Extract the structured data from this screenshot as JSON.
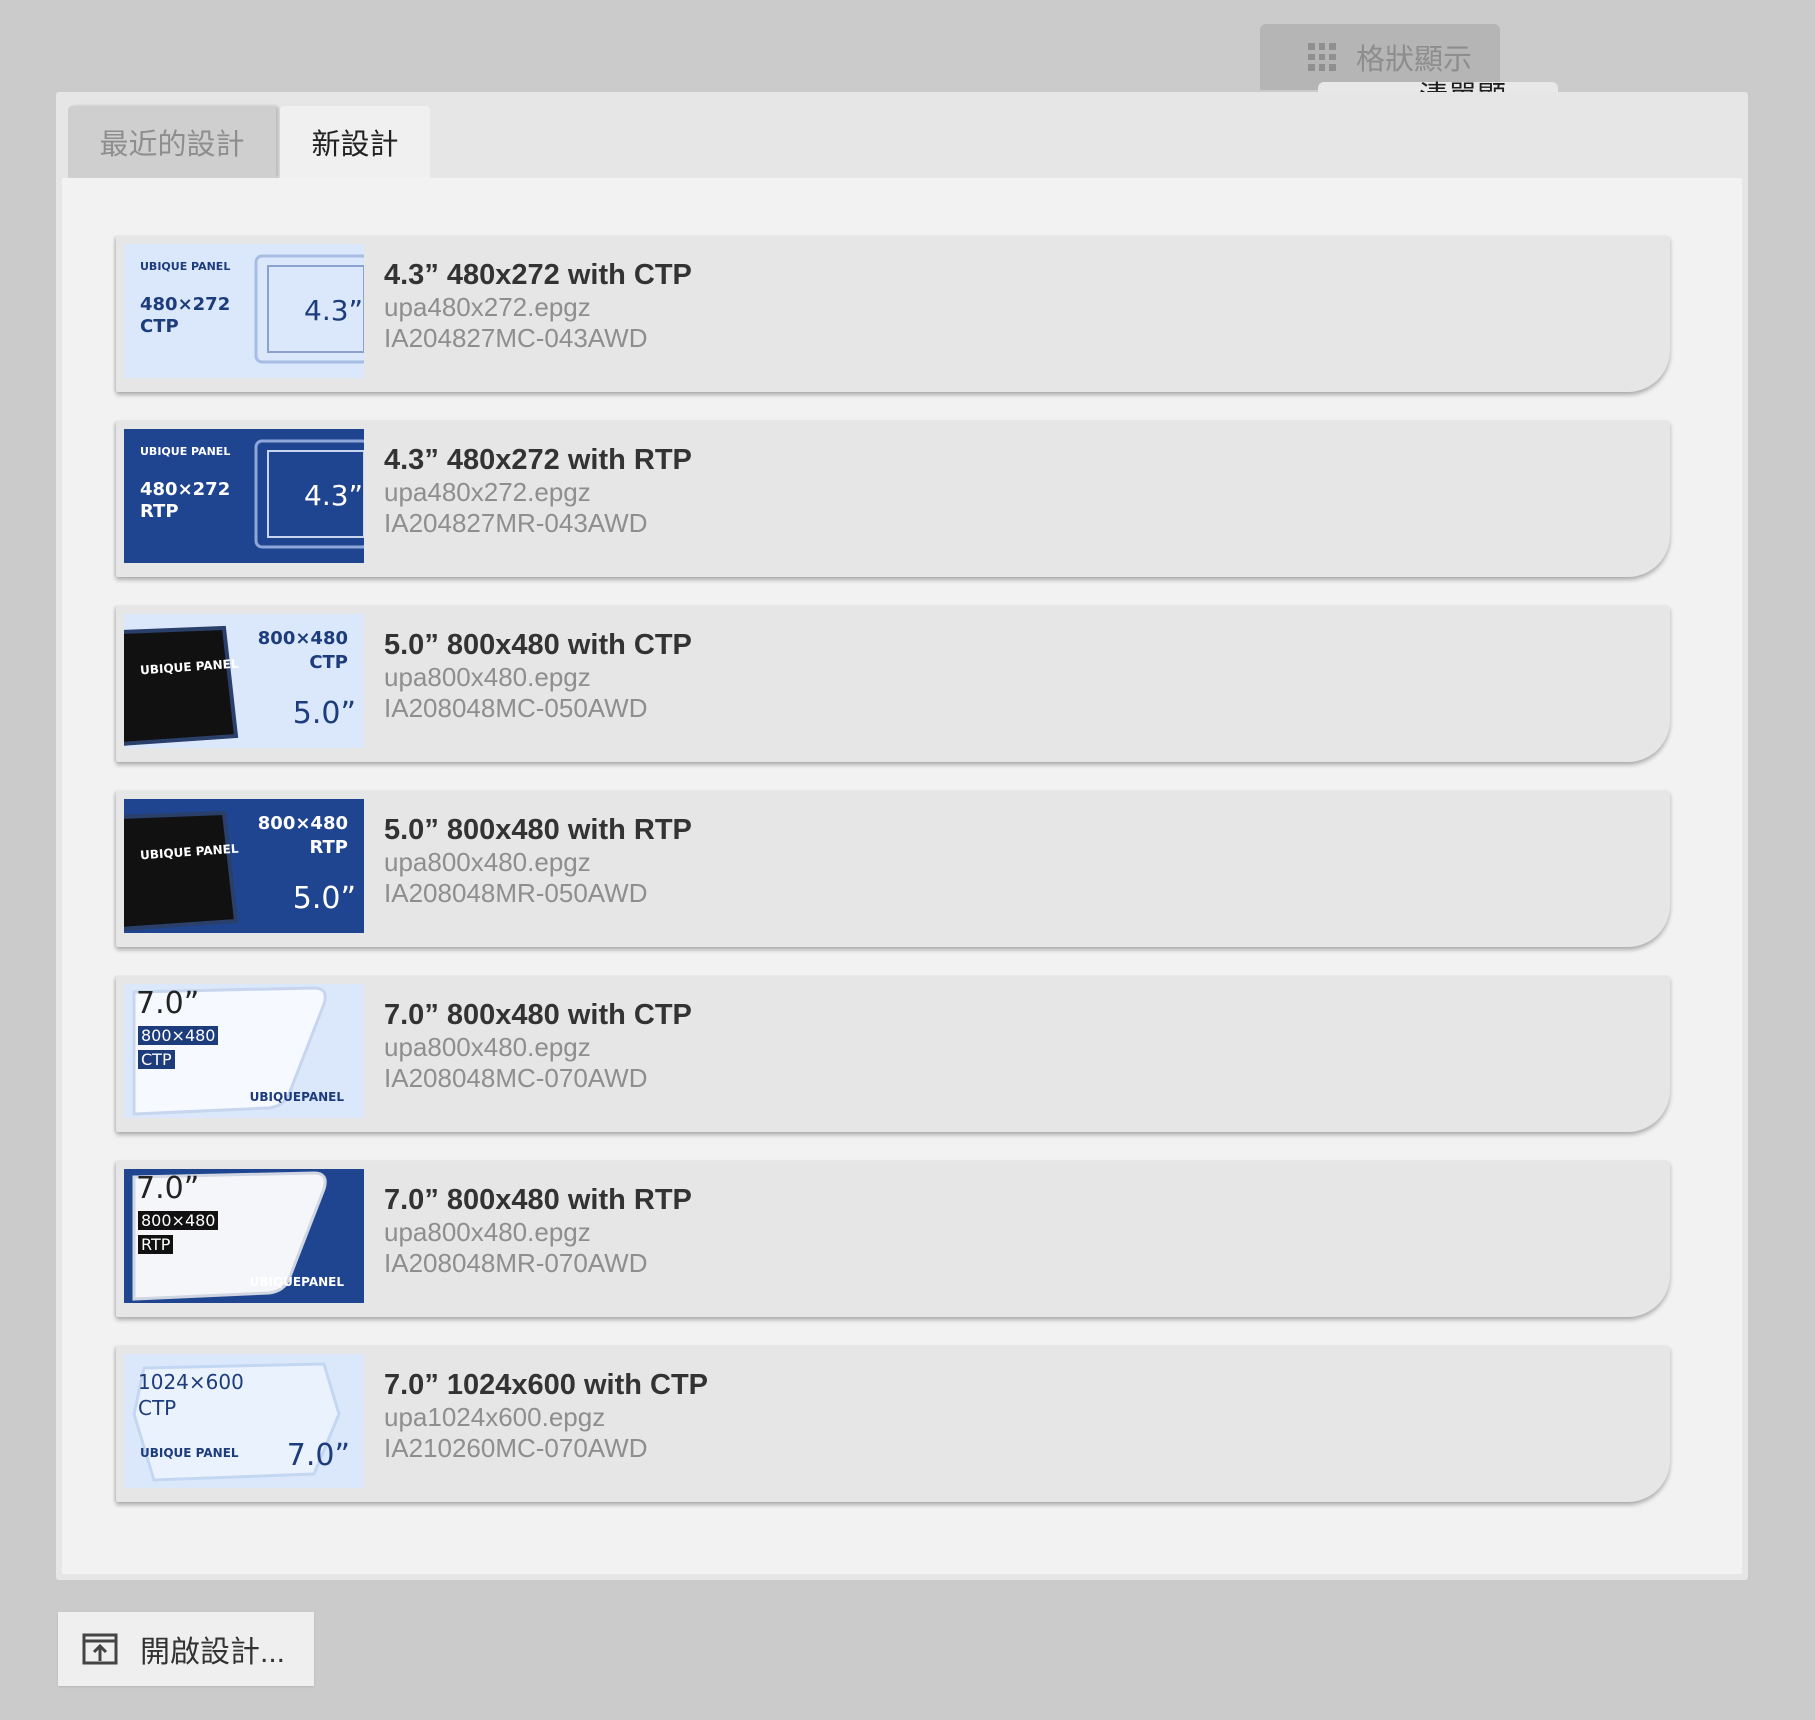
{
  "view_toggle": {
    "grid_label": "格狀顯示",
    "list_label": "清單顯示",
    "active": "list"
  },
  "tabs": [
    {
      "label": "最近的設計",
      "active": false
    },
    {
      "label": "新設計",
      "active": true
    }
  ],
  "designs": [
    {
      "title": "4.3” 480x272 with CTP",
      "file": "upa480x272.epgz",
      "part": "IA204827MC-043AWD",
      "thumb": {
        "style": "light",
        "brand": "UBIQUE PANEL",
        "line1": "480×272",
        "line2": "CTP",
        "size": "4.3”"
      }
    },
    {
      "title": "4.3” 480x272 with RTP",
      "file": "upa480x272.epgz",
      "part": "IA204827MR-043AWD",
      "thumb": {
        "style": "dark",
        "brand": "UBIQUE PANEL",
        "line1": "480×272",
        "line2": "RTP",
        "size": "4.3”"
      }
    },
    {
      "title": "5.0” 800x480 with CTP",
      "file": "upa800x480.epgz",
      "part": "IA208048MC-050AWD",
      "thumb": {
        "style": "light",
        "brand": "UBIQUE PANEL",
        "line1": "800×480",
        "line2": "CTP",
        "size": "5.0”"
      }
    },
    {
      "title": "5.0” 800x480 with RTP",
      "file": "upa800x480.epgz",
      "part": "IA208048MR-050AWD",
      "thumb": {
        "style": "dark",
        "brand": "UBIQUE PANEL",
        "line1": "800×480",
        "line2": "RTP",
        "size": "5.0”"
      }
    },
    {
      "title": "7.0” 800x480 with CTP",
      "file": "upa800x480.epgz",
      "part": "IA208048MC-070AWD",
      "thumb": {
        "style": "light",
        "brand": "UBIQUEPANEL",
        "line1": "800×480",
        "line2": "CTP",
        "size": "7.0”"
      }
    },
    {
      "title": "7.0” 800x480 with RTP",
      "file": "upa800x480.epgz",
      "part": "IA208048MR-070AWD",
      "thumb": {
        "style": "dark",
        "brand": "UBIQUEPANEL",
        "line1": "800×480",
        "line2": "RTP",
        "size": "7.0”"
      }
    },
    {
      "title": "7.0” 1024x600 with CTP",
      "file": "upa1024x600.epgz",
      "part": "IA210260MC-070AWD",
      "thumb": {
        "style": "light",
        "brand": "UBIQUE PANEL",
        "line1": "1024×600",
        "line2": "CTP",
        "size": "7.0”"
      }
    }
  ],
  "open_button": {
    "label": "開啟設計..."
  },
  "colors": {
    "dark_thumb": "#1f4591",
    "light_thumb": "#dbe8fb",
    "thumb_text": "#1d3c7c"
  }
}
